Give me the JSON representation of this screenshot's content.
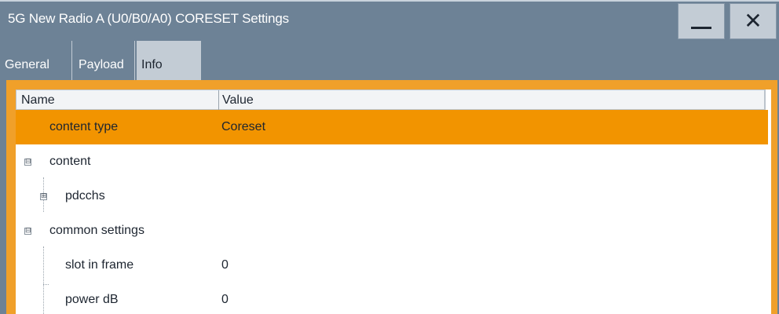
{
  "window": {
    "title": "5G New Radio A (U0/B0/A0) CORESET Settings",
    "minimize_icon": "minimize-icon",
    "close_icon": "close-icon",
    "close_glyph": "✕"
  },
  "tabs": [
    {
      "label": "General"
    },
    {
      "label": "Payload"
    },
    {
      "label": "Info",
      "active": true
    }
  ],
  "table": {
    "columns": [
      "Name",
      "Value"
    ],
    "rows": [
      {
        "name": "content type",
        "value": "Coreset",
        "selected": true
      },
      {
        "name": "content",
        "value": "",
        "expander": "⊟"
      },
      {
        "name": "pdcchs",
        "value": "",
        "expander": "⊞"
      },
      {
        "name": "common settings",
        "value": "",
        "expander": "⊟"
      },
      {
        "name": "slot in frame",
        "value": "0"
      },
      {
        "name": "power dB",
        "value": "0"
      }
    ]
  },
  "colors": {
    "accent": "#f29400",
    "titlebar": "#6d8296",
    "tab_active": "#c3ccd5"
  }
}
